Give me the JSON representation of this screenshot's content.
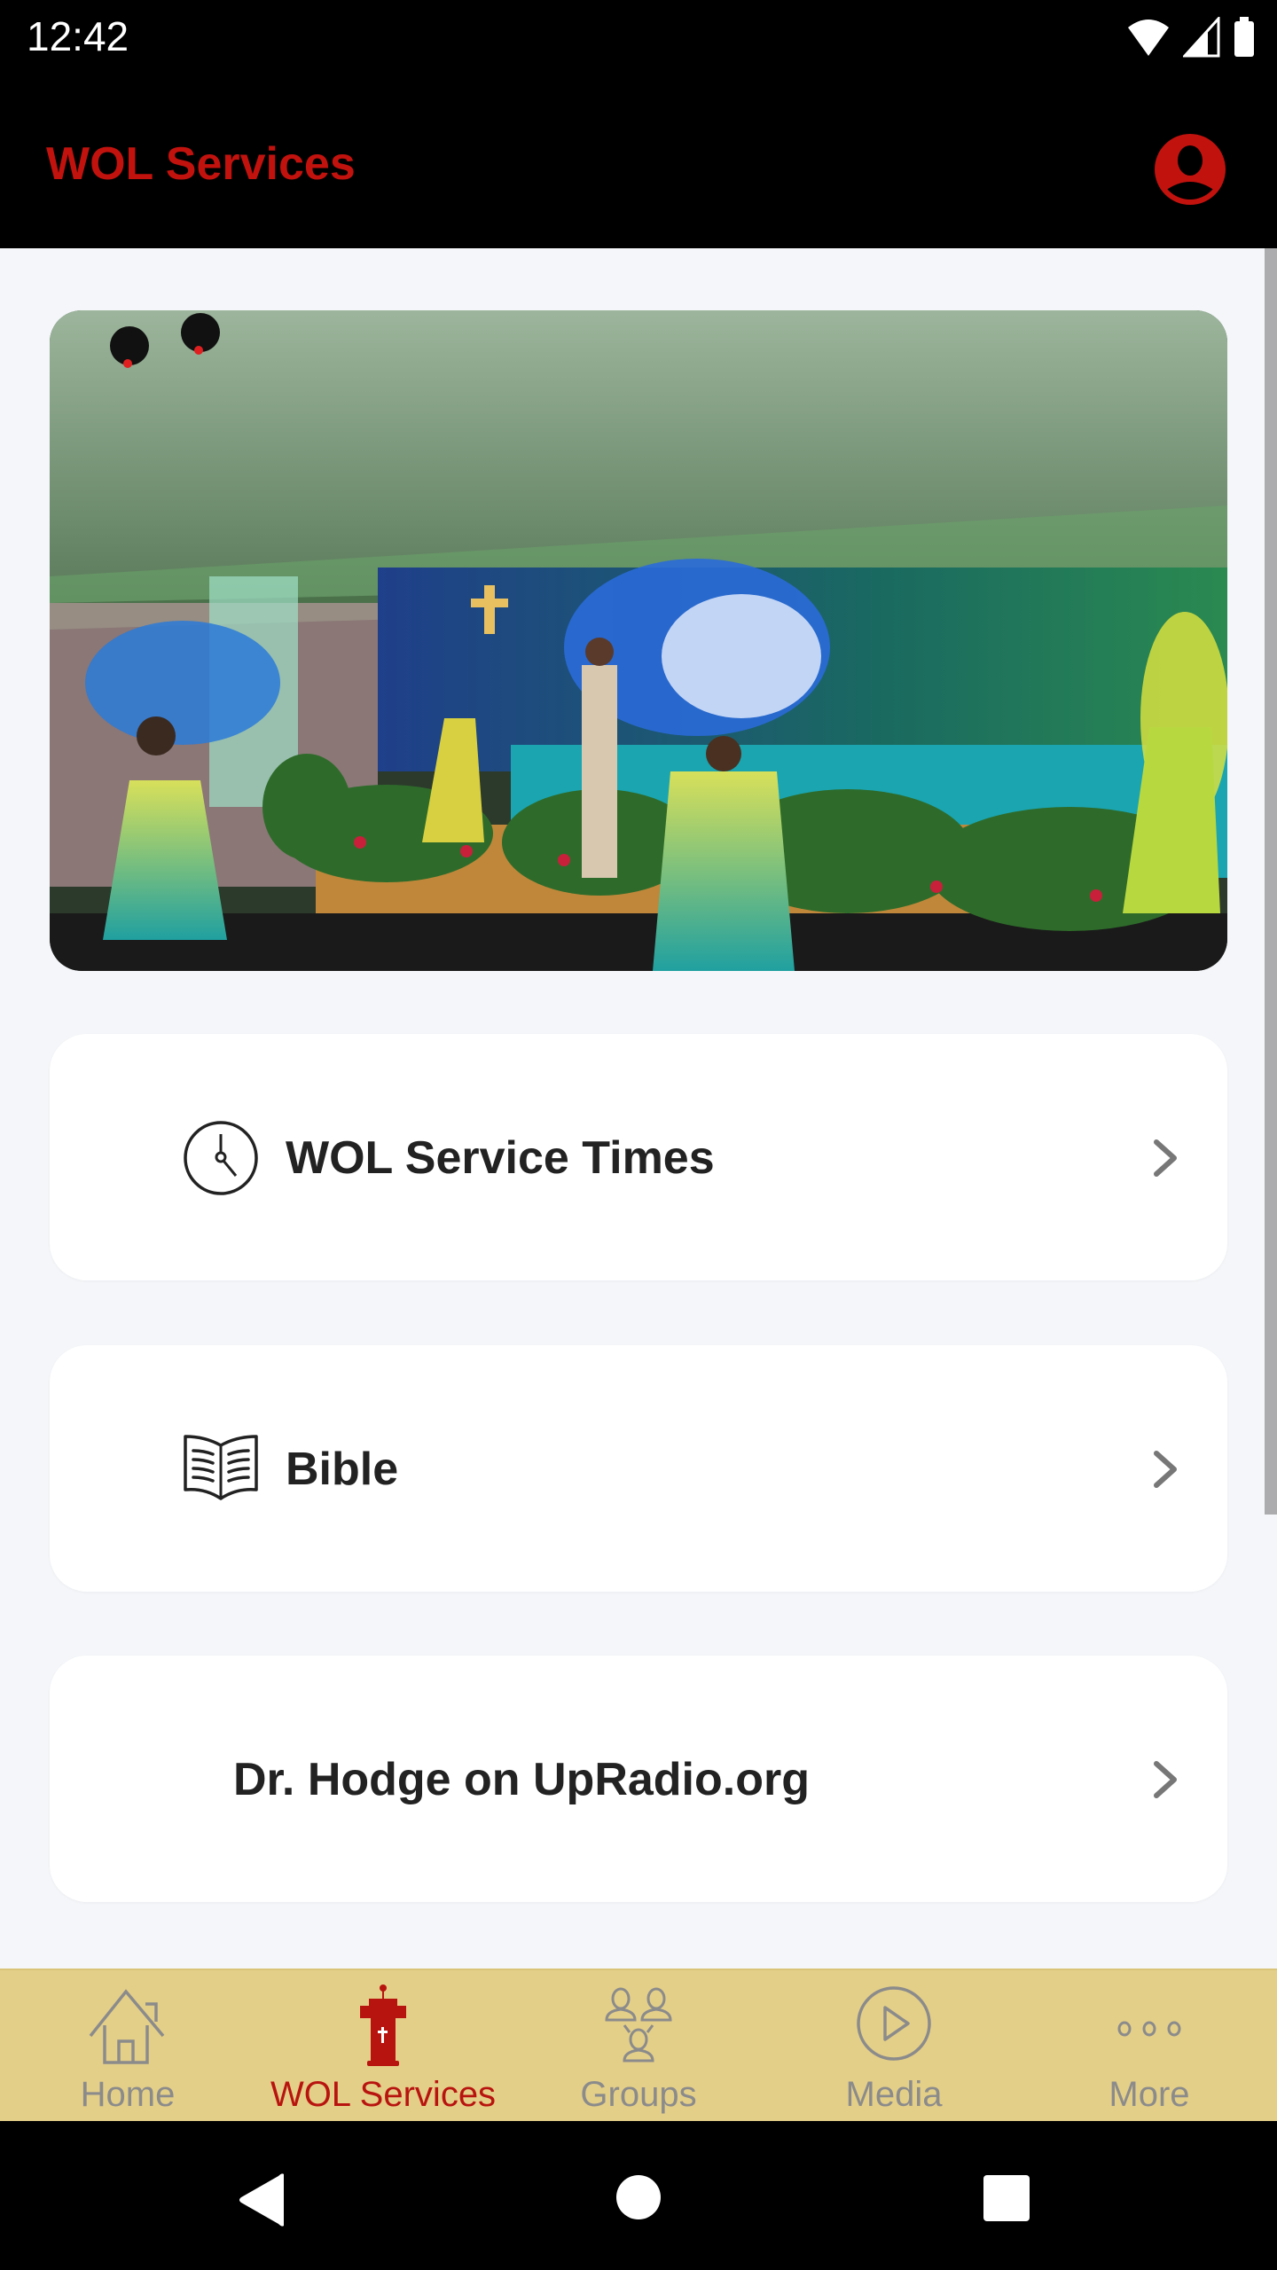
{
  "status_bar": {
    "time": "12:42",
    "icons": [
      "wifi-icon",
      "signal-icon",
      "battery-icon"
    ]
  },
  "app_bar": {
    "title": "WOL Services",
    "profile_icon": "account-circle-icon"
  },
  "hero_image": {
    "description": "Church stage with praise dancers waving blue and white flags"
  },
  "menu_items": [
    {
      "label": "WOL Service Times",
      "icon": "clock-icon"
    },
    {
      "label": "Bible",
      "icon": "open-book-icon"
    },
    {
      "label": "Dr. Hodge on UpRadio.org",
      "icon": ""
    }
  ],
  "bottom_nav": {
    "items": [
      {
        "label": "Home",
        "icon": "home-icon",
        "active": false
      },
      {
        "label": "WOL Services",
        "icon": "pulpit-icon",
        "active": true
      },
      {
        "label": "Groups",
        "icon": "groups-icon",
        "active": false
      },
      {
        "label": "Media",
        "icon": "play-circle-icon",
        "active": false
      },
      {
        "label": "More",
        "icon": "more-dots-icon",
        "active": false
      }
    ]
  },
  "colors": {
    "accent": "#c1120e",
    "nav_bg": "#e4cf88",
    "inactive": "#8b8b8b",
    "page_bg": "#f4f6f9"
  }
}
